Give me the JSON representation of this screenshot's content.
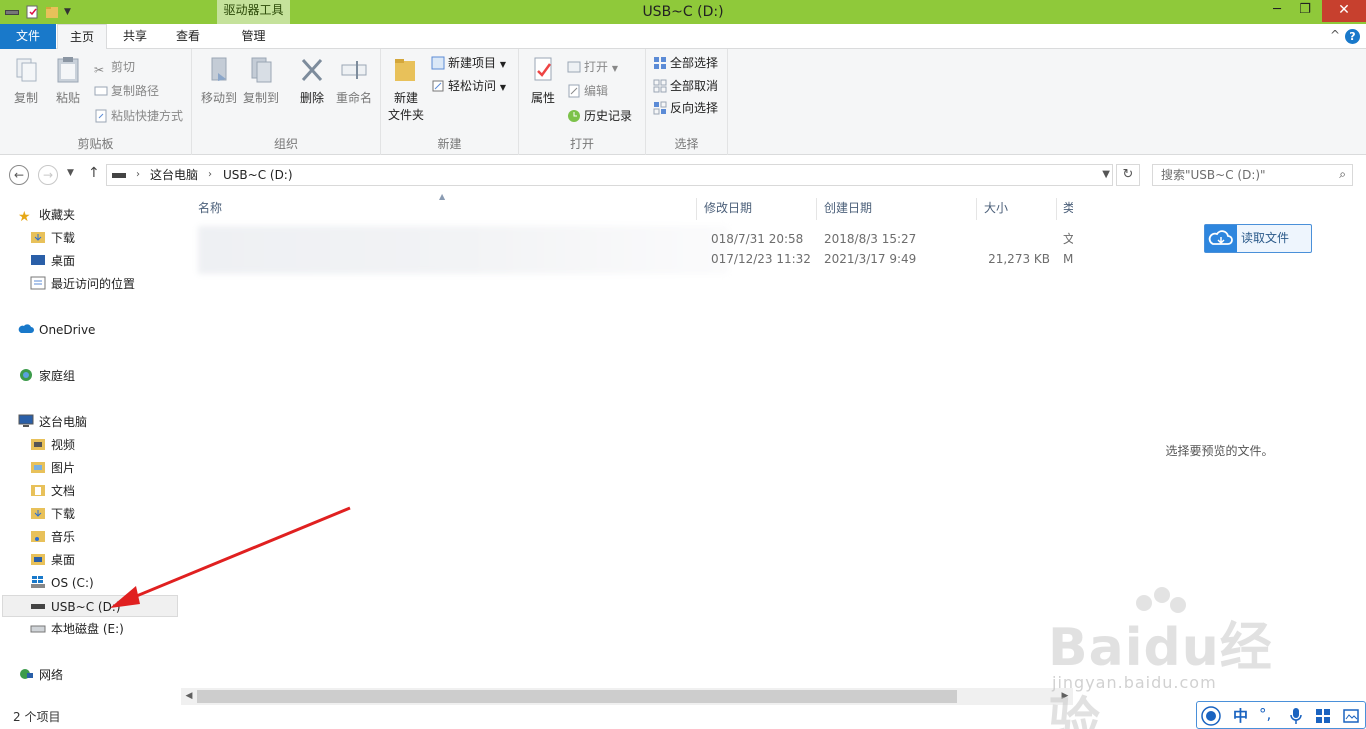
{
  "window": {
    "title": "USB~C (D:)",
    "context_tab_header": "驱动器工具",
    "title_color": "#8fc93a"
  },
  "tabs": {
    "file": "文件",
    "home": "主页",
    "share": "共享",
    "view": "查看",
    "manage": "管理"
  },
  "ribbon": {
    "clipboard": {
      "label": "剪贴板",
      "copy": "复制",
      "paste": "粘贴",
      "cut": "剪切",
      "copy_path": "复制路径",
      "paste_shortcut": "粘贴快捷方式"
    },
    "organize": {
      "label": "组织",
      "move_to": "移动到",
      "copy_to": "复制到",
      "delete": "删除",
      "rename": "重命名"
    },
    "new": {
      "label": "新建",
      "new_folder_line1": "新建",
      "new_folder_line2": "文件夹",
      "new_item": "新建项目",
      "easy_access": "轻松访问"
    },
    "open": {
      "label": "打开",
      "properties": "属性",
      "open": "打开",
      "edit": "编辑",
      "history": "历史记录"
    },
    "select": {
      "label": "选择",
      "select_all": "全部选择",
      "select_none": "全部取消",
      "invert": "反向选择"
    }
  },
  "address": {
    "crumbs": [
      "这台电脑",
      "USB~C (D:)"
    ],
    "search_placeholder": "搜索\"USB~C (D:)\""
  },
  "nav": {
    "favorites": "收藏夹",
    "fav_items": [
      "下载",
      "桌面",
      "最近访问的位置"
    ],
    "onedrive": "OneDrive",
    "homegroup": "家庭组",
    "thispc": "这台电脑",
    "pc_items": [
      "视频",
      "图片",
      "文档",
      "下载",
      "音乐",
      "桌面",
      "OS (C:)",
      "USB~C (D:)",
      "本地磁盘 (E:)"
    ],
    "network": "网络"
  },
  "columns": {
    "name": "名称",
    "modified": "修改日期",
    "created": "创建日期",
    "size": "大小",
    "type": "类"
  },
  "files": [
    {
      "modified": "018/7/31 20:58",
      "created": "2018/8/3 15:27",
      "size": "",
      "type": "文"
    },
    {
      "modified": "017/12/23 11:32",
      "created": "2021/3/17 9:49",
      "size": "21,273 KB",
      "type": "M"
    }
  ],
  "preview": {
    "read_button": "读取文件",
    "empty_text": "选择要预览的文件。"
  },
  "status": {
    "item_count": "2 个项目"
  },
  "ime": {
    "mode": "中"
  },
  "watermark": {
    "logo": "Baidu经验",
    "url": "jingyan.baidu.com"
  }
}
